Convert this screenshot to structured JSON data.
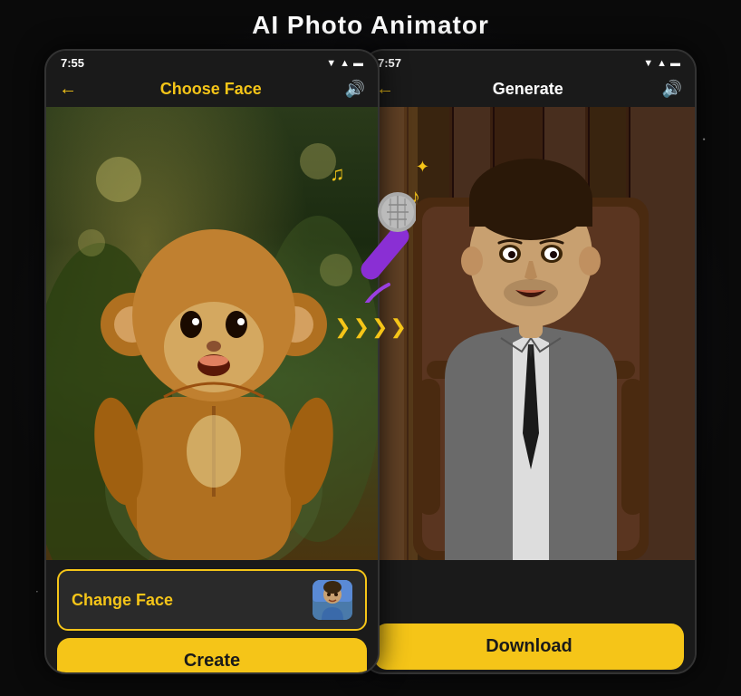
{
  "page": {
    "title": "AI Photo Animator",
    "background_color": "#0a0a0a"
  },
  "phone_left": {
    "status": {
      "time": "7:55",
      "icons": "▼▲ 🔋"
    },
    "nav": {
      "back_icon": "←",
      "title": "Choose Face",
      "sound_icon": "🔊"
    },
    "bottom": {
      "change_face_label": "Change Face",
      "create_label": "Create"
    }
  },
  "phone_right": {
    "status": {
      "time": "7:57",
      "icons": "▼▲ 🔋"
    },
    "nav": {
      "back_icon": "←",
      "title": "Generate",
      "sound_icon": "🔊"
    },
    "bottom": {
      "download_label": "Download"
    }
  },
  "overlay": {
    "sparkle": "✦",
    "note1": "♫",
    "note2": "♪",
    "chevrons": [
      "»",
      "»",
      "»"
    ]
  }
}
